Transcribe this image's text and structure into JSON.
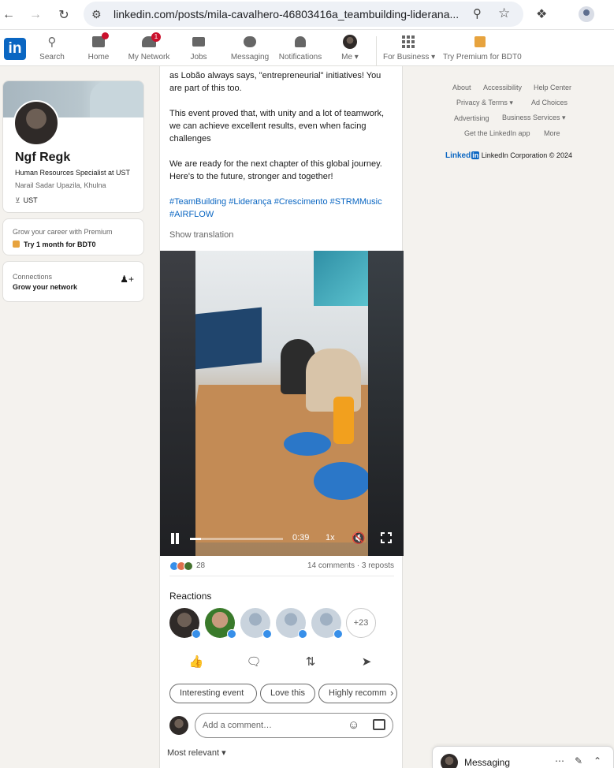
{
  "browser": {
    "url": "linkedin.com/posts/mila-cavalhero-46803416a_teambuilding-liderana..."
  },
  "nav": {
    "logo": "in",
    "items": [
      {
        "label": "Search",
        "badge": ""
      },
      {
        "label": "Home",
        "badge": "dot"
      },
      {
        "label": "My Network",
        "badge": "1"
      },
      {
        "label": "Jobs",
        "badge": ""
      },
      {
        "label": "Messaging",
        "badge": ""
      },
      {
        "label": "Notifications",
        "badge": ""
      },
      {
        "label": "Me ▾",
        "badge": ""
      },
      {
        "label": "For Business ▾",
        "badge": ""
      },
      {
        "label": "Try Premium for BDT0",
        "badge": ""
      }
    ]
  },
  "profile": {
    "name": "Ngf Regk",
    "headline": "Human Resources Specialist at UST",
    "location": "Narail Sadar Upazila, Khulna",
    "org": "UST"
  },
  "premium": {
    "line1": "Grow your career with Premium",
    "line2": "Try 1 month for BDT0"
  },
  "connections": {
    "title": "Connections",
    "subtitle": "Grow your network"
  },
  "post": {
    "text1": "as Lobão always says, \"entrepreneurial\" initiatives! You are part of this too.",
    "text2": "This event proved that, with unity and a lot of teamwork, we can achieve excellent results, even when facing challenges",
    "text3": "We are ready for the next chapter of this global journey. Here's to the future, stronger and together!",
    "hashtags": "#TeamBuilding #Liderança #Crescimento #STRMMusic #AIRFLOW",
    "show_translation": "Show translation"
  },
  "video": {
    "time": "0:39",
    "speed": "1x",
    "progress": 0.12
  },
  "social": {
    "reaction_count": "28",
    "comments_reposts": "14 comments · 3 reposts",
    "reaction_colors": [
      "#378fe9",
      "#df704d",
      "#44712e"
    ]
  },
  "reactions": {
    "title": "Reactions",
    "more": "+23"
  },
  "chips": [
    "Interesting event",
    "Love this",
    "Highly recomm"
  ],
  "comment": {
    "placeholder": "Add a comment…"
  },
  "sort": "Most relevant ▾",
  "footer": {
    "links": [
      "About",
      "Accessibility",
      "Help Center",
      "Privacy & Terms ▾",
      "Ad Choices",
      "Advertising",
      "Business Services ▾",
      "Get the LinkedIn app",
      "More"
    ],
    "brand": "Linked",
    "brand_box": "in",
    "corp": "LinkedIn Corporation © 2024"
  },
  "messaging": {
    "label": "Messaging"
  }
}
